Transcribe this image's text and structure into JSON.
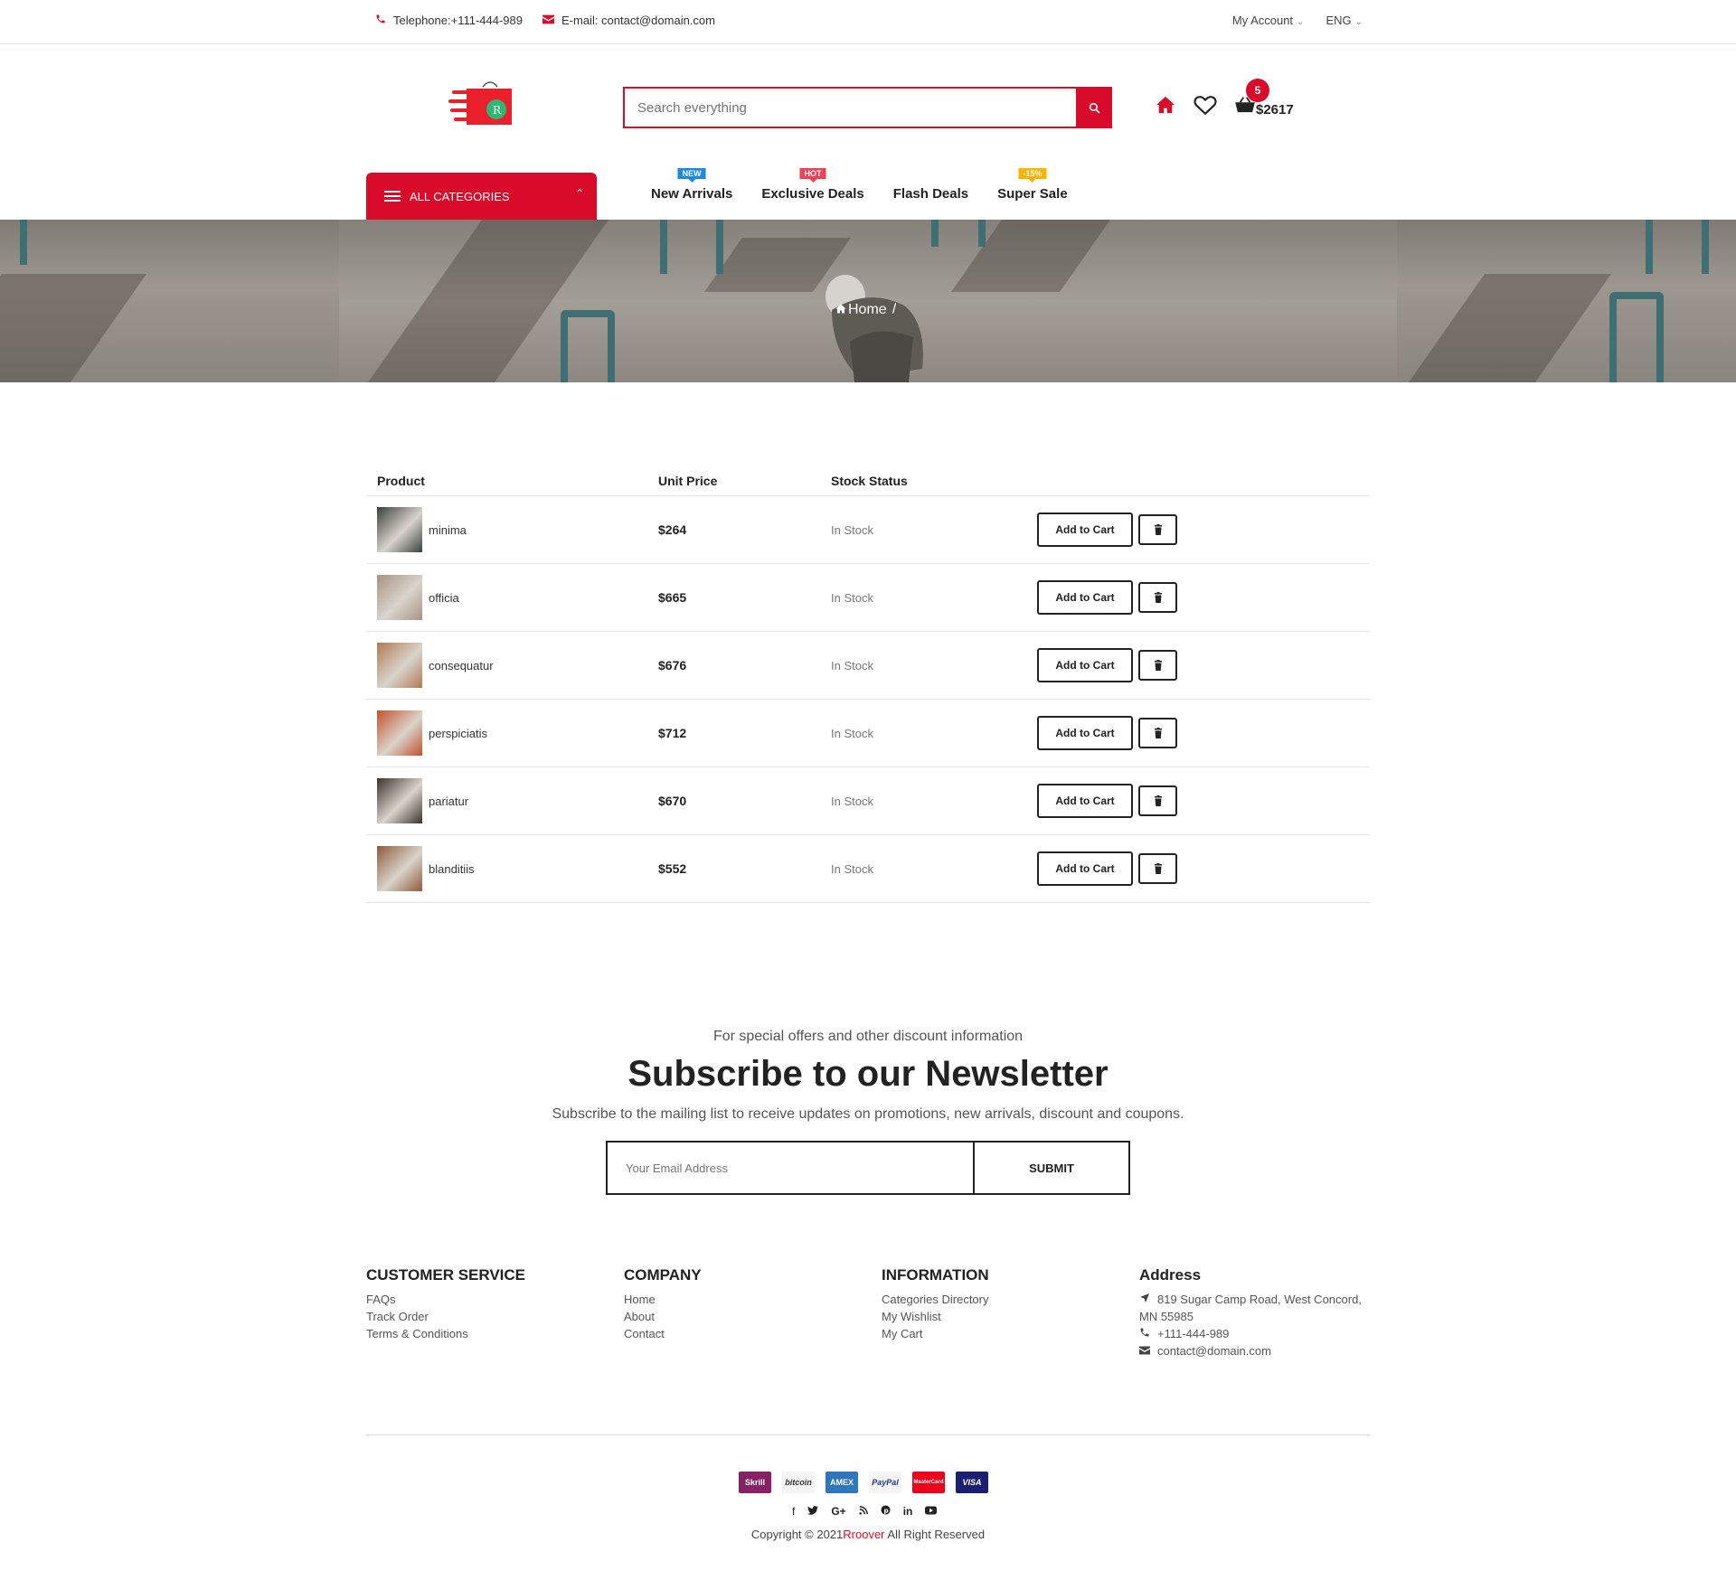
{
  "topbar": {
    "telephone": "Telephone:+111-444-989",
    "email": "E-mail: contact@domain.com",
    "account": "My Account",
    "language": "ENG"
  },
  "header": {
    "search_placeholder": "Search everything",
    "cart_count": "5",
    "cart_total": "$2617"
  },
  "nav": {
    "all_categories": "ALL CATEGORIES",
    "items": [
      {
        "label": "New Arrivals",
        "tag": "NEW",
        "tag_color": "#1e88e5"
      },
      {
        "label": "Exclusive Deals",
        "tag": "HOT",
        "tag_color": "#ef4056"
      },
      {
        "label": "Flash Deals",
        "tag": "",
        "tag_color": ""
      },
      {
        "label": "Super Sale",
        "tag": "-15%",
        "tag_color": "#f7b500"
      }
    ]
  },
  "breadcrumb": {
    "home": "Home",
    "sep": "/"
  },
  "wishlist": {
    "headers": {
      "product": "Product",
      "unit_price": "Unit Price",
      "stock_status": "Stock Status"
    },
    "add_to_cart_label": "Add to Cart",
    "rows": [
      {
        "name": "minima",
        "price": "$264",
        "stock": "In Stock",
        "thumb": "#3a3f3d"
      },
      {
        "name": "officia",
        "price": "$665",
        "stock": "In Stock",
        "thumb": "#a89384"
      },
      {
        "name": "consequatur",
        "price": "$676",
        "stock": "In Stock",
        "thumb": "#b07a55"
      },
      {
        "name": "perspiciatis",
        "price": "$712",
        "stock": "In Stock",
        "thumb": "#c4512b"
      },
      {
        "name": "pariatur",
        "price": "$670",
        "stock": "In Stock",
        "thumb": "#3b312c"
      },
      {
        "name": "blanditiis",
        "price": "$552",
        "stock": "In Stock",
        "thumb": "#8d5a3a"
      }
    ]
  },
  "newsletter": {
    "pre": "For special offers and other discount information",
    "title": "Subscribe to our Newsletter",
    "subtitle": "Subscribe to the mailing list to receive updates on promotions, new arrivals, discount and coupons.",
    "placeholder": "Your Email Address",
    "submit": "SUBMIT"
  },
  "footer": {
    "customer_service": {
      "title": "CUSTOMER SERVICE",
      "links": [
        "FAQs",
        "Track Order",
        "Terms & Conditions"
      ]
    },
    "company": {
      "title": "COMPANY",
      "links": [
        "Home",
        "About",
        "Contact"
      ]
    },
    "information": {
      "title": "INFORMATION",
      "links": [
        "Categories Directory",
        "My Wishlist",
        "My Cart"
      ]
    },
    "address": {
      "title": "Address",
      "line1": "819 Sugar Camp Road, West Concord,",
      "line2": "MN 55985",
      "phone": "+111-444-989",
      "email": "contact@domain.com"
    },
    "payments": [
      "Skrill",
      "bitcoin",
      "AMEX",
      "PayPal",
      "MasterCard",
      "VISA"
    ],
    "copyright_prefix": "Copyright © 2021",
    "brand": "Rroover",
    "copyright_suffix": " All Right Reserved"
  }
}
